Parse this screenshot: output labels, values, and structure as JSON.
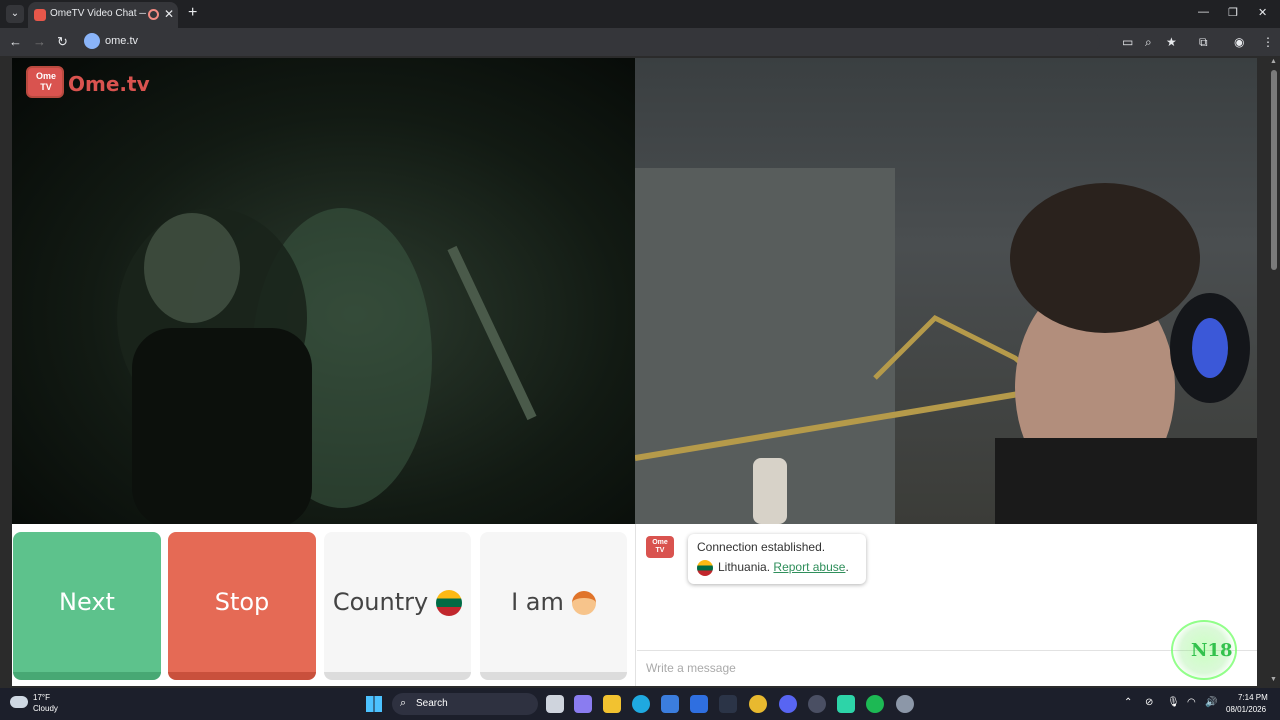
{
  "browser": {
    "tab_title": "OmeTV Video Chat — Ome",
    "tab_close": "✕",
    "new_tab": "+",
    "url": "ome.tv",
    "window": {
      "minimize": "—",
      "restore": "❐",
      "close": "✕"
    },
    "nav": {
      "back": "←",
      "forward": "→",
      "reload": "↻"
    }
  },
  "site": {
    "logo_label": "Ome TV",
    "brand": "Ome.tv"
  },
  "controls": {
    "next_label": "Next",
    "stop_label": "Stop",
    "country_label": "Country",
    "iam_label": "I am"
  },
  "chat": {
    "logo_label": "Ome TV",
    "message_line1": "Connection established.",
    "country": "Lithuania",
    "country_suffix": ".",
    "report_label": "Report abuse",
    "report_suffix": ".",
    "input_placeholder": "Write a message",
    "overlay_label": "N18"
  },
  "taskbar": {
    "temperature": "17°F",
    "weather": "Cloudy",
    "search_label": "Search",
    "time": "7:14 PM",
    "date": "08/01/2026"
  },
  "colors": {
    "next": "#5dc28c",
    "stop": "#e56a55",
    "brand": "#d9534f",
    "link": "#2f8f5b"
  },
  "icons": {
    "flag": "lithuania-flag-icon",
    "avatar": "boy-emoji-icon"
  }
}
